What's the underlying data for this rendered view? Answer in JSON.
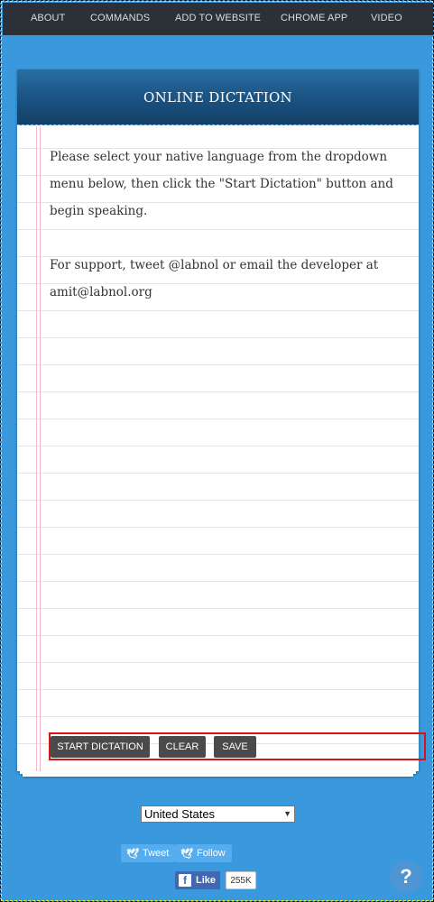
{
  "nav": {
    "items": [
      {
        "label": "ABOUT"
      },
      {
        "label": "COMMANDS"
      },
      {
        "label": "ADD TO WEBSITE"
      },
      {
        "label": "CHROME APP"
      },
      {
        "label": "VIDEO"
      }
    ]
  },
  "panel": {
    "title": "ONLINE DICTATION",
    "instruction": "Please select your native language from the dropdown menu below, then click the \"Start Dictation\" button and begin speaking.",
    "support_prefix": "For support, tweet ",
    "support_handle": "@labnol",
    "support_mid": " or email the ",
    "support_developer": "developer",
    "support_suffix": " at amit@labnol.org"
  },
  "buttons": {
    "start": "START DICTATION",
    "clear": "CLEAR",
    "save": "SAVE"
  },
  "language": {
    "selected": "United States"
  },
  "social": {
    "tweet": "Tweet",
    "follow": "Follow",
    "like": "Like",
    "like_count": "255K"
  },
  "help": {
    "label": "?"
  },
  "colors": {
    "page_background": "#3a98dc",
    "nav_background": "#2b3137",
    "header_gradient_top": "#2a6ea2",
    "header_gradient_bottom": "#123f66",
    "button_background": "#4a4a4a",
    "twitter_blue": "#55acee",
    "facebook_blue": "#4267b2",
    "highlight_border": "#d01616"
  }
}
